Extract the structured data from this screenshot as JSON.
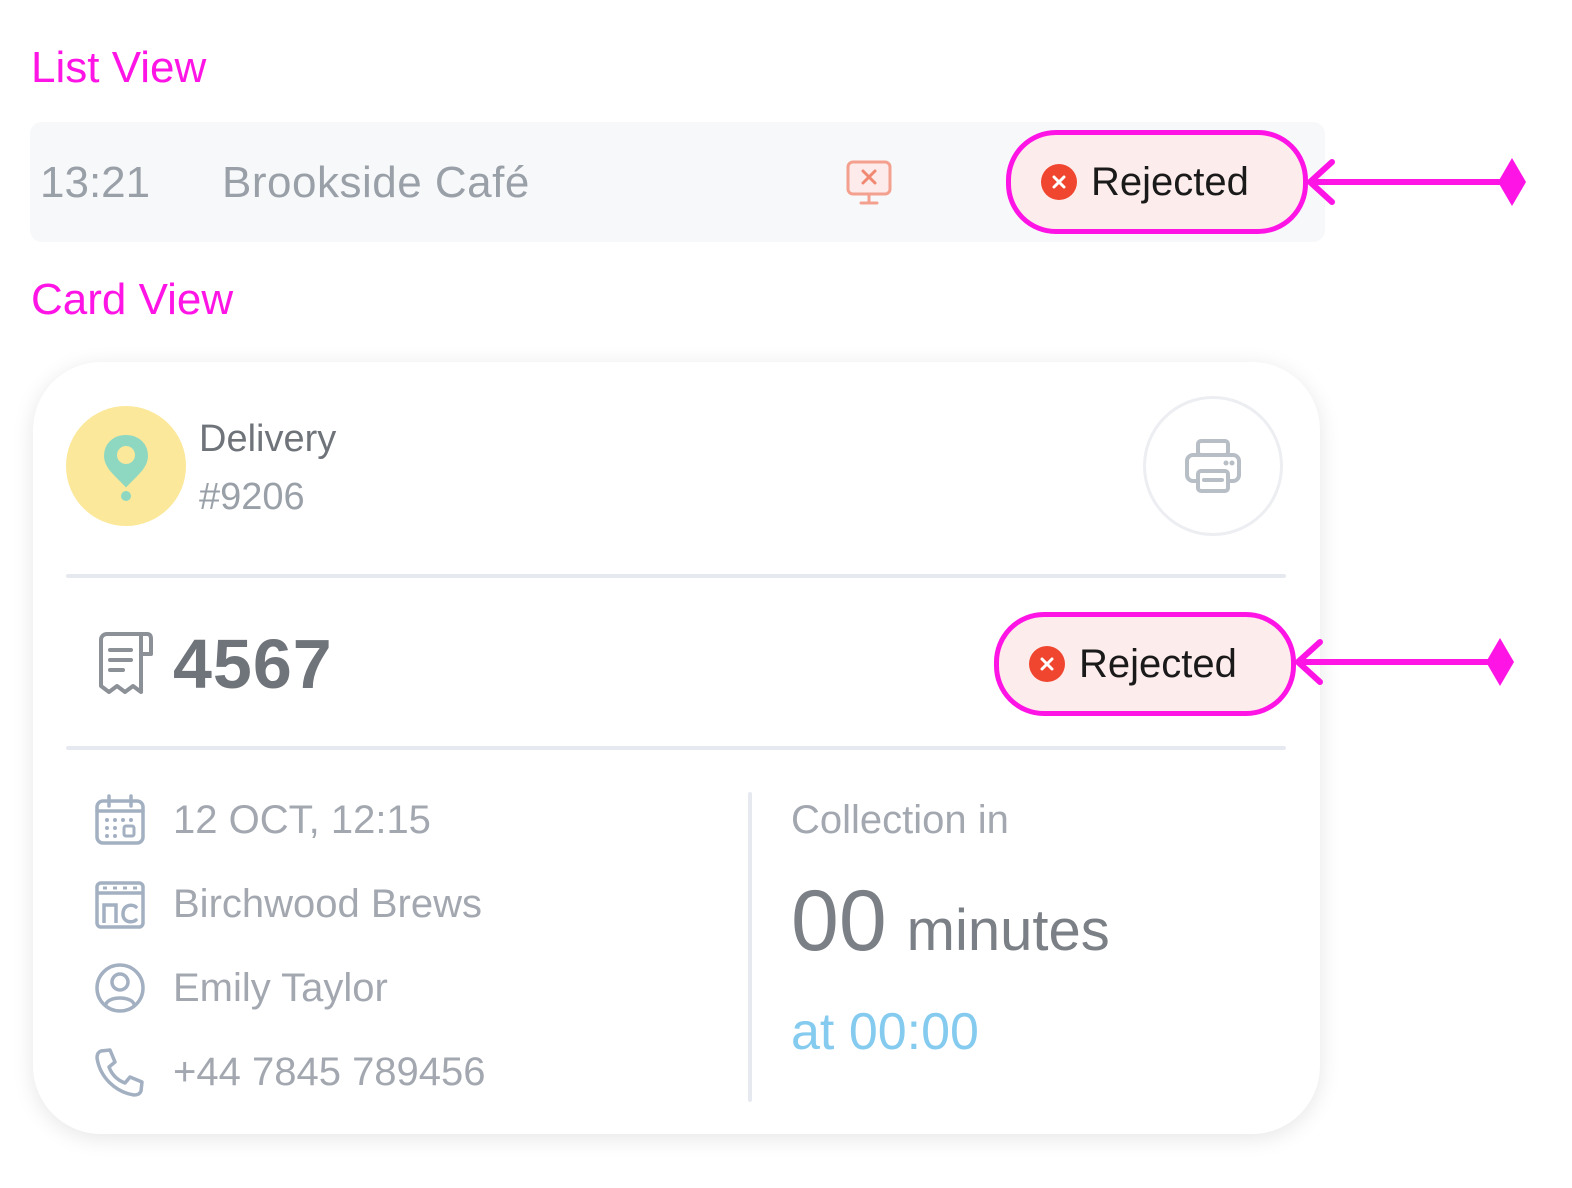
{
  "sections": {
    "list_label": "List View",
    "card_label": "Card View"
  },
  "list_row": {
    "time": "13:21",
    "name": "Brookside Café",
    "screen_icon": "screen-x-icon",
    "status": "Rejected"
  },
  "card": {
    "order_type": "Delivery",
    "order_ref": "#9206",
    "type_icon": "location-pin-icon",
    "print_icon": "printer-icon",
    "order_number": "4567",
    "status": "Rejected",
    "details": {
      "date": "12 OCT, 12:15",
      "venue": "Birchwood Brews",
      "customer": "Emily Taylor",
      "phone": "+44 7845 789456"
    },
    "collection": {
      "label": "Collection in",
      "minutes_value": "00",
      "minutes_unit": "minutes",
      "at": "at 00:00"
    }
  },
  "colors": {
    "annotation": "#ff14e6",
    "reject_red": "#f0452e",
    "badge_bg": "#fdecec",
    "accent_blue": "#84cbef",
    "avatar_yellow": "#fbe89a"
  }
}
